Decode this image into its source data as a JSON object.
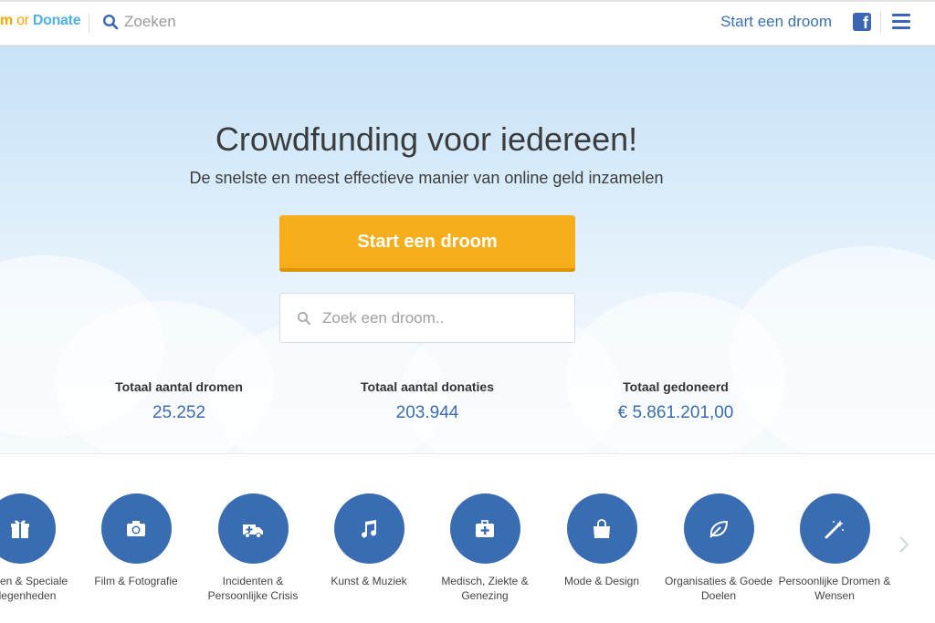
{
  "header": {
    "logo_part1": "m",
    "logo_part2": " or ",
    "logo_part3": "Donate",
    "search_placeholder": "Zoeken",
    "start_link": "Start een droom",
    "facebook_icon": "facebook-icon",
    "menu_icon": "hamburger-menu-icon"
  },
  "hero": {
    "title": "Crowdfunding voor iedereen!",
    "subtitle": "De snelste en meest effectieve manier van online geld inzamelen",
    "cta_label": "Start een droom",
    "search_placeholder": "Zoek een droom.."
  },
  "stats": [
    {
      "label": "Totaal aantal dromen",
      "value": "25.252"
    },
    {
      "label": "Totaal aantal donaties",
      "value": "203.944"
    },
    {
      "label": "Totaal gedoneerd",
      "value": "€ 5.861.201,00"
    }
  ],
  "categories": [
    {
      "name": "Feesten & Speciale Gelegenheden",
      "icon": "gift-icon"
    },
    {
      "name": "Film & Fotografie",
      "icon": "camera-icon"
    },
    {
      "name": "Incidenten & Persoonlijke Crisis",
      "icon": "ambulance-icon"
    },
    {
      "name": "Kunst & Muziek",
      "icon": "music-note-icon"
    },
    {
      "name": "Medisch, Ziekte & Genezing",
      "icon": "medical-kit-icon"
    },
    {
      "name": "Mode & Design",
      "icon": "shopping-bag-icon"
    },
    {
      "name": "Organisaties & Goede Doelen",
      "icon": "leaf-icon"
    },
    {
      "name": "Persoonlijke Dromen & Wensen",
      "icon": "magic-wand-icon"
    }
  ],
  "colors": {
    "brand_blue": "#3a6cb1",
    "cta_orange": "#f6ae1d",
    "link_blue": "#3a6fb0"
  }
}
